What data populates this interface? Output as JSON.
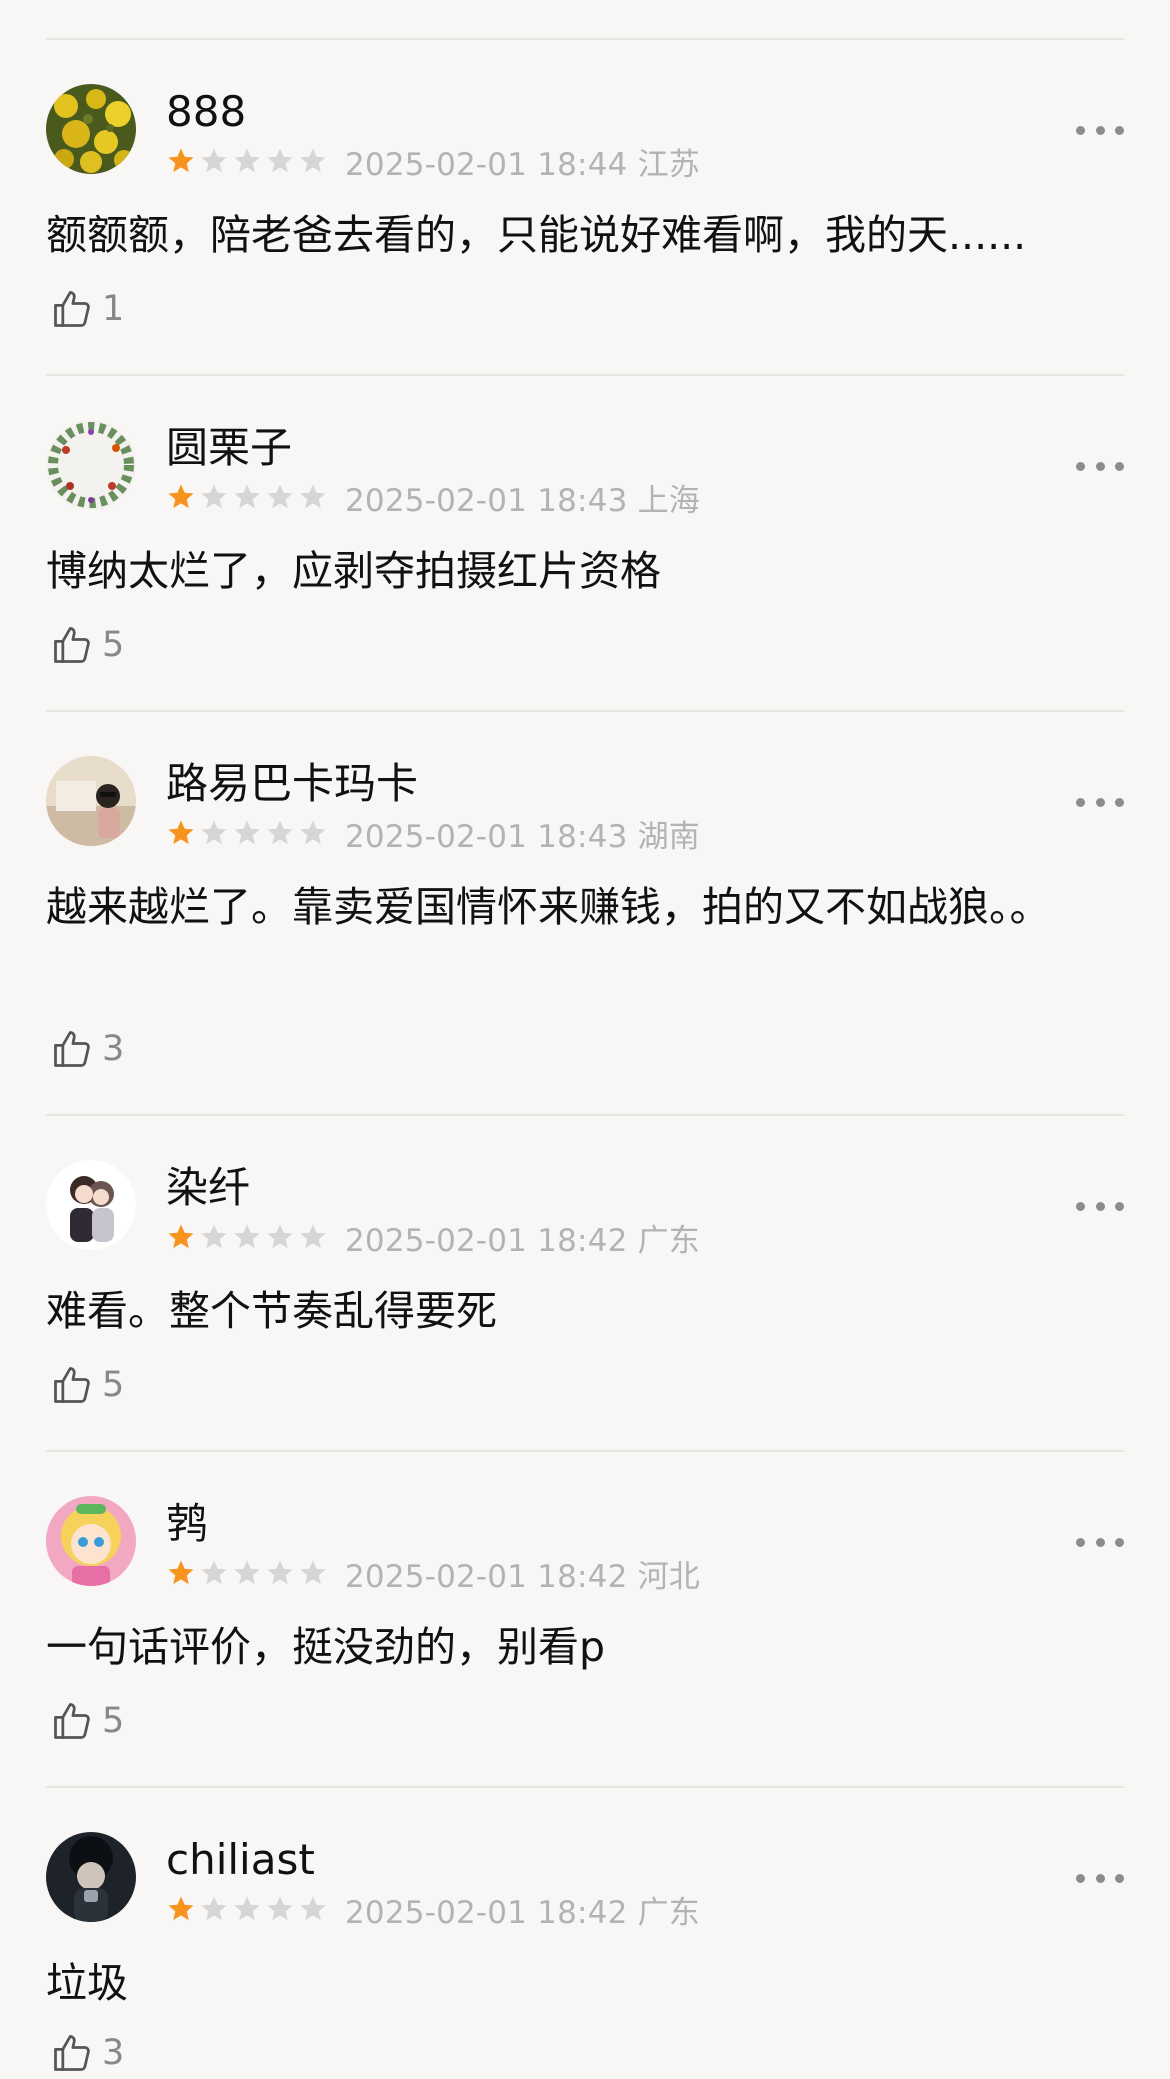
{
  "colors": {
    "background": "#f8f7f5",
    "star_active": "#f7941d",
    "star_inactive": "#d6d6d6",
    "meta_text": "#b3b3b3",
    "divider": "#e8e6e3"
  },
  "reviews": [
    {
      "username": "888",
      "rating": 1,
      "max_rating": 5,
      "timestamp": "2025-02-01 18:44",
      "location": "江苏",
      "meta": "2025-02-01 18:44 江苏",
      "content": "额额额，陪老爸去看的，只能说好难看啊，我的天......",
      "likes": "1",
      "avatar_icon": "yellow-flowers-avatar"
    },
    {
      "username": "圆栗子",
      "rating": 1,
      "max_rating": 5,
      "timestamp": "2025-02-01 18:43",
      "location": "上海",
      "meta": "2025-02-01 18:43 上海",
      "content": "博纳太烂了，应剥夺拍摄红片资格",
      "likes": "5",
      "avatar_icon": "floral-wreath-avatar"
    },
    {
      "username": "路易巴卡玛卡",
      "rating": 1,
      "max_rating": 5,
      "timestamp": "2025-02-01 18:43",
      "location": "湖南",
      "meta": "2025-02-01 18:43 湖南",
      "content": "越来越烂了。靠卖爱国情怀来赚钱，拍的又不如战狼。。",
      "likes": "3",
      "avatar_icon": "photo-person-avatar"
    },
    {
      "username": "染纤",
      "rating": 1,
      "max_rating": 5,
      "timestamp": "2025-02-01 18:42",
      "location": "广东",
      "meta": "2025-02-01 18:42 广东",
      "content": "难看。整个节奏乱得要死",
      "likes": "5",
      "avatar_icon": "anime-couple-avatar"
    },
    {
      "username": "鹁",
      "rating": 1,
      "max_rating": 5,
      "timestamp": "2025-02-01 18:42",
      "location": "河北",
      "meta": "2025-02-01 18:42 河北",
      "content": "一句话评价，挺没劲的，别看p",
      "likes": "5",
      "avatar_icon": "cartoon-girl-avatar"
    },
    {
      "username": "chiliast",
      "rating": 1,
      "max_rating": 5,
      "timestamp": "2025-02-01 18:42",
      "location": "广东",
      "meta": "2025-02-01 18:42 广东",
      "content": "垃圾",
      "likes": "3",
      "avatar_icon": "dark-portrait-avatar"
    }
  ]
}
